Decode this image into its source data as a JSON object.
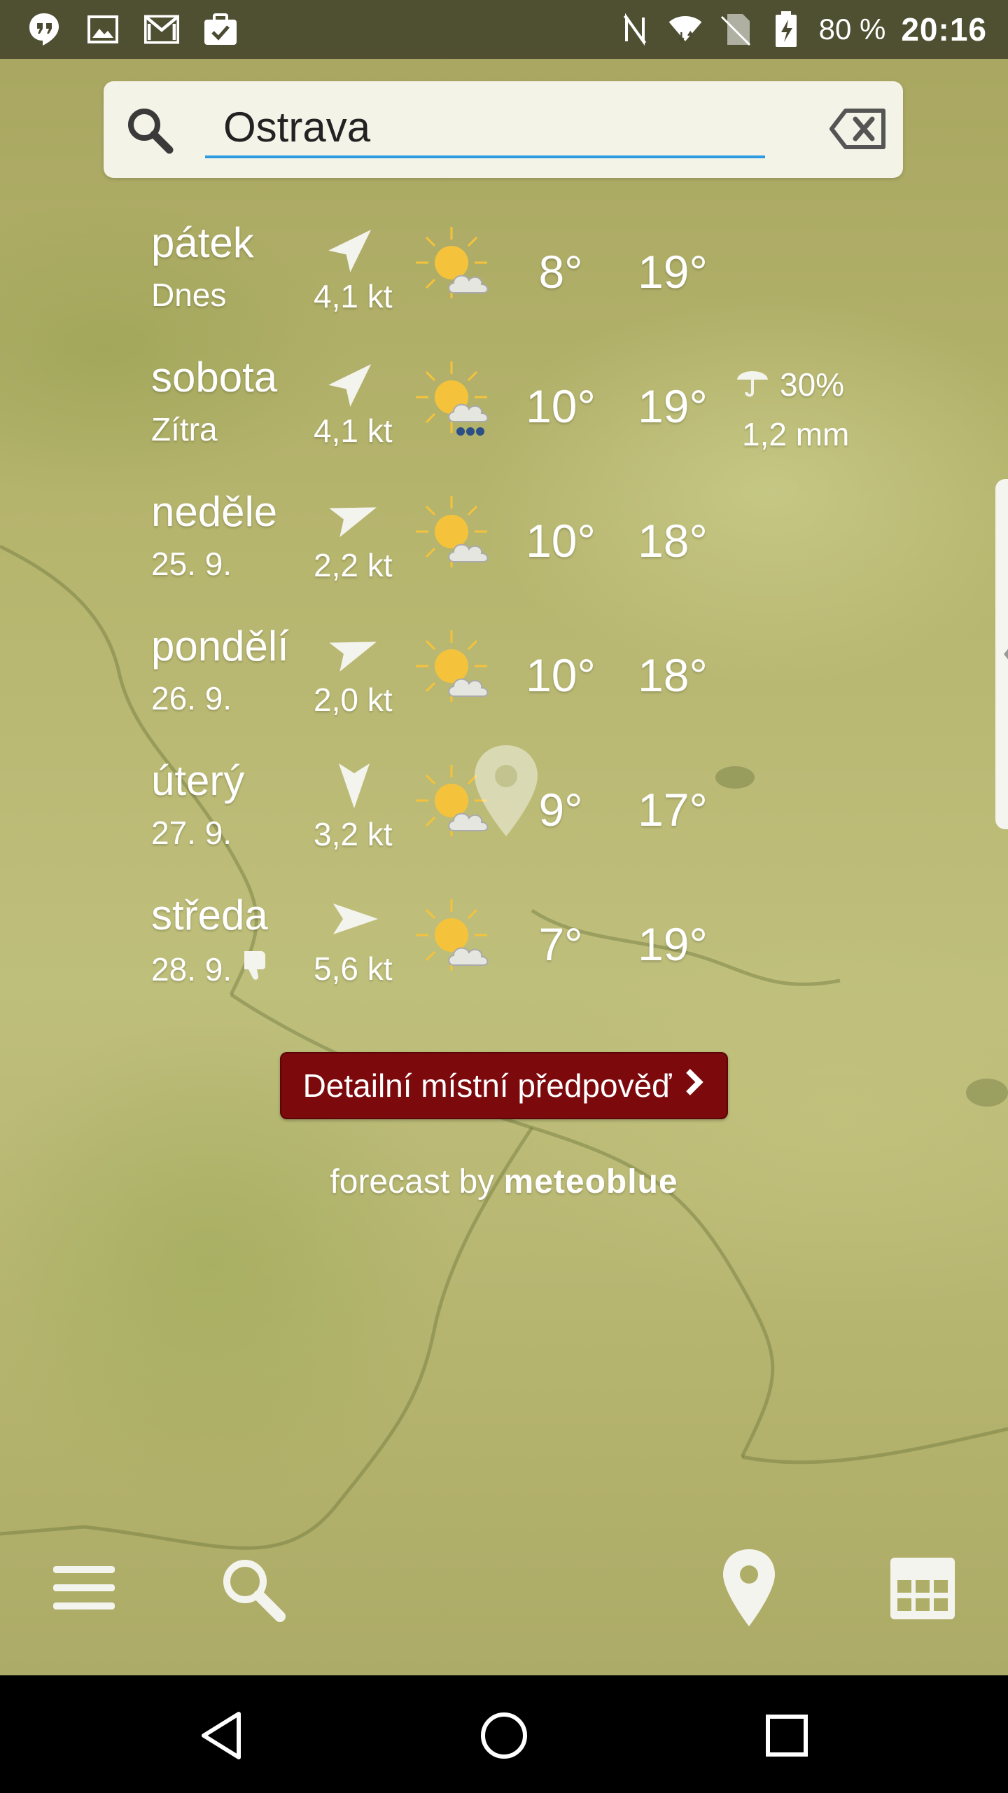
{
  "status_bar": {
    "battery": "80 %",
    "time": "20:16",
    "left_icons": [
      "hangouts-icon",
      "image-icon",
      "gmail-icon",
      "task-icon"
    ],
    "right_icons": [
      "nfc-icon",
      "wifi-icon",
      "no-sim-icon",
      "battery-charging-icon"
    ]
  },
  "search": {
    "value": "Ostrava",
    "icon": "search-icon",
    "clear_icon": "backspace-icon"
  },
  "forecast": [
    {
      "day": "pátek",
      "sub": "Dnes",
      "wind": "4,1 kt",
      "wind_direction": "north-east",
      "icon": "sun-cloud",
      "min": "8°",
      "max": "19°"
    },
    {
      "day": "sobota",
      "sub": "Zítra",
      "wind": "4,1 kt",
      "wind_direction": "north-east",
      "icon": "sun-cloud-rain",
      "min": "10°",
      "max": "19°",
      "precip_chance": "30%",
      "precip_amount": "1,2 mm"
    },
    {
      "day": "neděle",
      "sub": "25. 9.",
      "wind": "2,2 kt",
      "wind_direction": "east-north-east",
      "icon": "sun-cloud",
      "min": "10°",
      "max": "18°"
    },
    {
      "day": "pondělí",
      "sub": "26. 9.",
      "wind": "2,0 kt",
      "wind_direction": "east-north-east",
      "icon": "sun-cloud",
      "min": "10°",
      "max": "18°"
    },
    {
      "day": "úterý",
      "sub": "27. 9.",
      "wind": "3,2 kt",
      "wind_direction": "south",
      "icon": "sun-cloud",
      "min": "9°",
      "max": "17°"
    },
    {
      "day": "středa",
      "sub": "28. 9.",
      "wind": "5,6 kt",
      "wind_direction": "east",
      "icon": "sun-cloud",
      "min": "7°",
      "max": "19°",
      "extra_icon": "thumbs-down-icon"
    }
  ],
  "detail_button": {
    "label": "Detailní místní předpověď",
    "color": "#7c0a0d"
  },
  "credit": {
    "prefix": "forecast by",
    "brand": "meteoblue"
  },
  "toolbar": [
    "menu-icon",
    "search-icon",
    "location-pin-icon",
    "calendar-grid-icon"
  ],
  "nav": [
    "back-icon",
    "home-icon",
    "recents-icon"
  ],
  "colors": {
    "accent": "#2e9be0",
    "sun": "#f5c33b",
    "map": "#b6b56e"
  }
}
